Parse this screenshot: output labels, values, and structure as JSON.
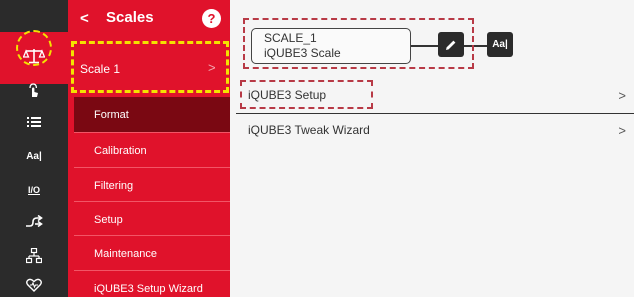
{
  "sidebar": {
    "icons": [
      "scale-icon",
      "touch-icon",
      "list-icon",
      "text-format-icon",
      "io-icon",
      "route-icon",
      "network-icon",
      "heart-icon"
    ],
    "text_format_glyph": "Aa|",
    "io_glyph": "I/O"
  },
  "menu": {
    "back_glyph": "<",
    "title": "Scales",
    "help_glyph": "?",
    "selected_item": "Scale 1",
    "selected_chevron": ">",
    "items": [
      {
        "label": "Format",
        "active": true
      },
      {
        "label": "Calibration"
      },
      {
        "label": "Filtering"
      },
      {
        "label": "Setup"
      },
      {
        "label": "Maintenance"
      },
      {
        "label": "iQUBE3 Setup Wizard"
      }
    ]
  },
  "main": {
    "scale_name": "SCALE_1",
    "scale_type": "iQUBE3 Scale",
    "aa_label": "Aa|",
    "rows": [
      {
        "label": "iQUBE3 Setup",
        "chevron": ">"
      },
      {
        "label": "iQUBE3 Tweak Wizard",
        "chevron": ">"
      }
    ]
  },
  "colors": {
    "accent": "#e0122b",
    "sidebar": "#2b2b2b",
    "active_item": "#7a0812",
    "highlight": "#f4e200",
    "annotation": "#b83a46"
  }
}
